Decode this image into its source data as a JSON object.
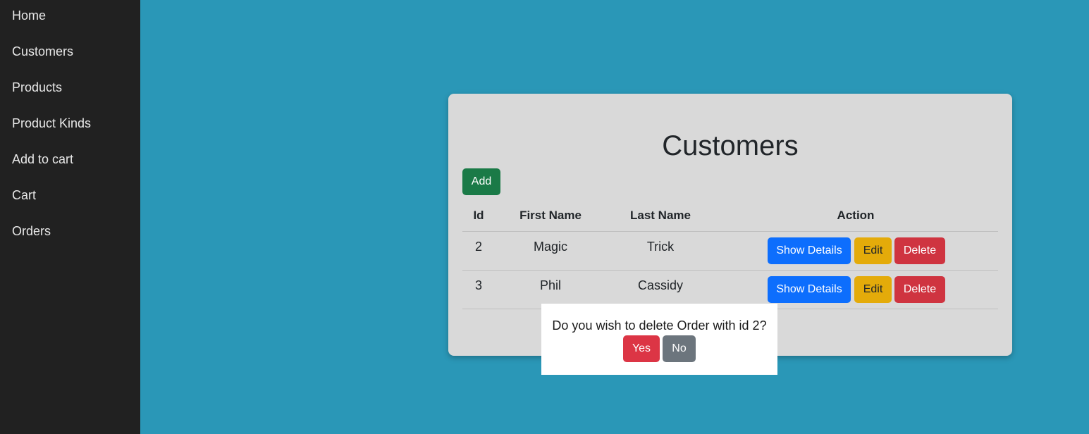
{
  "sidebar": {
    "items": [
      {
        "label": "Home"
      },
      {
        "label": "Customers"
      },
      {
        "label": "Products"
      },
      {
        "label": "Product Kinds"
      },
      {
        "label": "Add to cart"
      },
      {
        "label": "Cart"
      },
      {
        "label": "Orders"
      }
    ]
  },
  "main": {
    "title": "Customers",
    "add_label": "Add",
    "table": {
      "headers": [
        "Id",
        "First Name",
        "Last Name",
        "Action"
      ],
      "rows": [
        {
          "id": "2",
          "first_name": "Magic",
          "last_name": "Trick"
        },
        {
          "id": "3",
          "first_name": "Phil",
          "last_name": "Cassidy"
        }
      ],
      "actions": {
        "show_details": "Show Details",
        "edit": "Edit",
        "delete": "Delete"
      }
    }
  },
  "dialog": {
    "message": "Do you wish to delete Order with id 2?",
    "yes_label": "Yes",
    "no_label": "No"
  },
  "colors": {
    "background": "#2a97b7",
    "sidebar": "#212121",
    "card": "#d9d9d9",
    "add": "#1a7a47",
    "show_details": "#0d6efd",
    "edit": "#e4ab0a",
    "delete": "#cf3440",
    "yes": "#dc3545",
    "no": "#6c757d"
  }
}
